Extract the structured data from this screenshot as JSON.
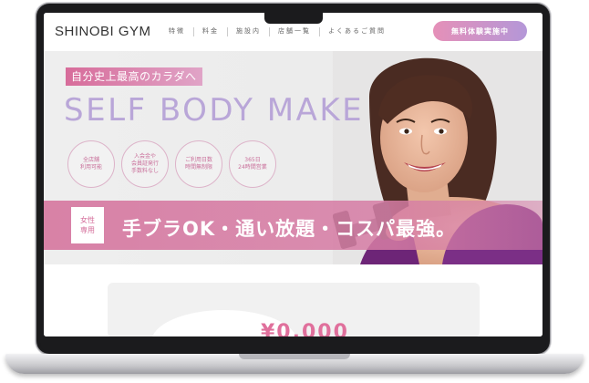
{
  "header": {
    "logo": "SHINOBI GYM",
    "nav": [
      "特徴",
      "料金",
      "施設内",
      "店舗一覧",
      "よくあるご質問"
    ],
    "cta": "無料体験実施中"
  },
  "hero": {
    "tagline": "自分史上最高のカラダへ",
    "headline": "SELF BODY MAKE",
    "features": [
      [
        "全店舗",
        "利用可能"
      ],
      [
        "入会金や",
        "会員証発行",
        "手数料なし"
      ],
      [
        "ご利用日数",
        "時間無制限"
      ],
      [
        "365日",
        "24時間営業"
      ]
    ],
    "badge": [
      "女性",
      "専用"
    ],
    "band_text": "手ブラOK・通い放題・コスパ最強。"
  },
  "lower": {
    "price_partial": "¥0,000"
  }
}
